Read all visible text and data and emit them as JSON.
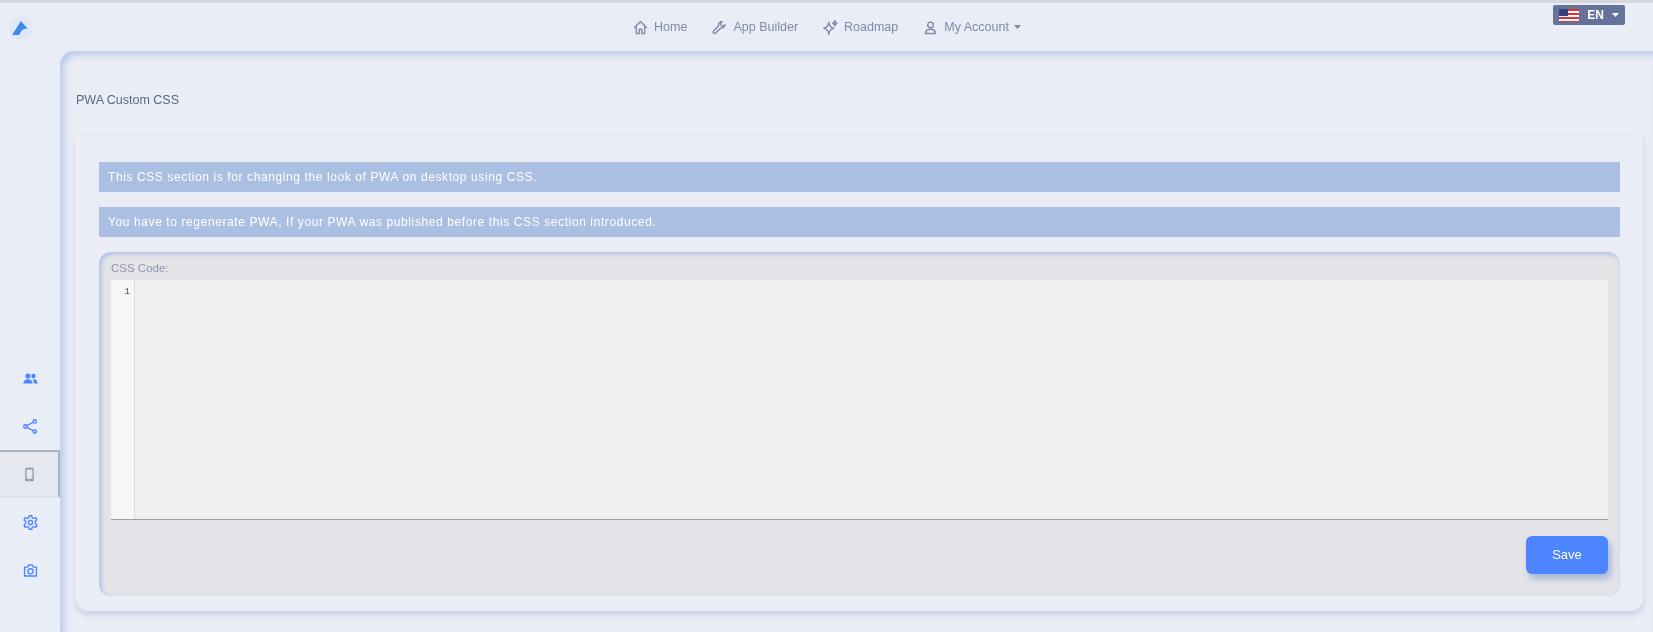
{
  "top_nav": [
    {
      "kind": "home",
      "label": "Home",
      "dropdown": false
    },
    {
      "kind": "wrench",
      "label": "App Builder",
      "dropdown": false
    },
    {
      "kind": "sparkle",
      "label": "Roadmap",
      "dropdown": false
    },
    {
      "kind": "user",
      "label": "My Account",
      "dropdown": true
    }
  ],
  "language": {
    "label": "EN"
  },
  "sidebar": {
    "items": [
      {
        "kind": "users",
        "selected": false
      },
      {
        "kind": "share",
        "selected": false
      },
      {
        "kind": "phone",
        "selected": true
      },
      {
        "kind": "gear",
        "selected": false
      },
      {
        "kind": "camera",
        "selected": false
      }
    ]
  },
  "page_title": "PWA Custom CSS",
  "notices": [
    "This CSS section is for changing the look of PWA on desktop using CSS.",
    "You have to regenerate PWA, If your PWA was published before this CSS section introduced."
  ],
  "editor": {
    "label": "CSS Code:",
    "line_numbers": [
      "1"
    ]
  },
  "save_button": "Save"
}
